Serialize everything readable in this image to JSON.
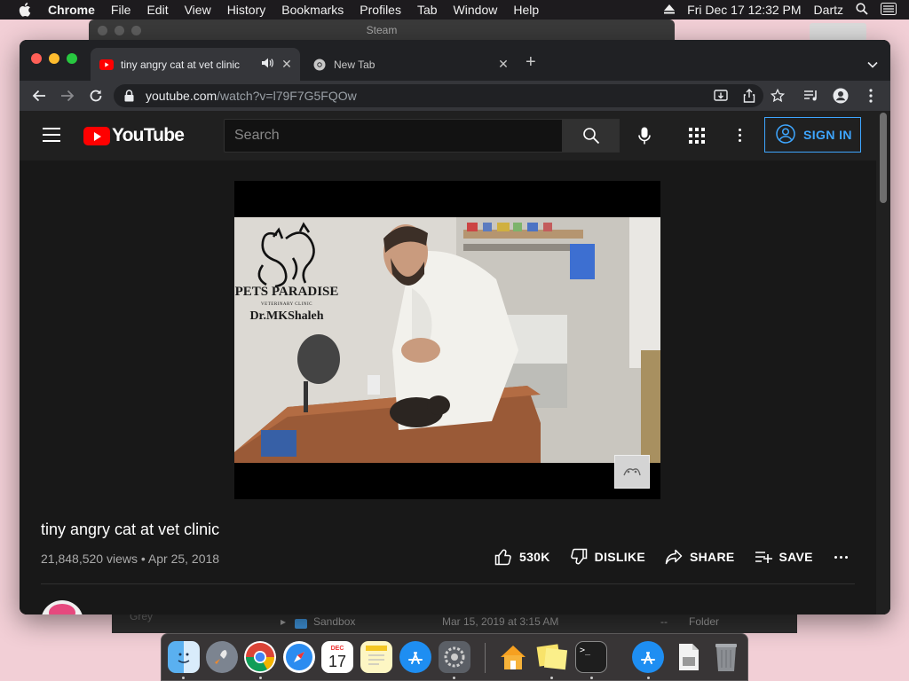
{
  "menubar": {
    "app_name": "Chrome",
    "items": [
      "File",
      "Edit",
      "View",
      "History",
      "Bookmarks",
      "Profiles",
      "Tab",
      "Window",
      "Help"
    ],
    "datetime": "Fri Dec 17  12:32 PM",
    "user": "Dartz"
  },
  "background": {
    "steam_title": "Steam",
    "finder_row": {
      "name": "Sandbox",
      "date": "Mar 15, 2019 at 3:15 AM",
      "size": "--",
      "kind": "Folder",
      "partial": "Grey"
    }
  },
  "browser": {
    "tabs": [
      {
        "title": "tiny angry cat at vet clinic",
        "active": true
      },
      {
        "title": "New Tab",
        "active": false
      }
    ],
    "url_domain": "youtube.com",
    "url_path": "/watch?v=l79F7G5FQOw"
  },
  "youtube": {
    "logo_text": "YouTube",
    "search_placeholder": "Search",
    "sign_in_label": "SIGN IN",
    "video": {
      "overlay_brand_line1": "PETS PARADISE",
      "overlay_brand_line2": "VETERINARY CLINIC",
      "overlay_brand_line3": "Dr.MKShaleh",
      "title": "tiny angry cat at vet clinic",
      "views": "21,848,520 views",
      "date": "Apr 25, 2018",
      "likes": "530K",
      "dislike_label": "DISLIKE",
      "share_label": "SHARE",
      "save_label": "SAVE"
    }
  },
  "dock": {
    "apps": [
      "Finder",
      "Launchpad",
      "Google Chrome",
      "Safari",
      "Calendar",
      "Notes",
      "App Store",
      "System Preferences",
      "Home",
      "Stickies",
      "Terminal",
      "App Store",
      "Preview",
      "Trash"
    ],
    "calendar_month": "DEC",
    "calendar_day": "17"
  },
  "colors": {
    "youtube_red": "#ff0000",
    "link_blue": "#3ea6ff",
    "desktop_pink": "#f2cfd6"
  }
}
